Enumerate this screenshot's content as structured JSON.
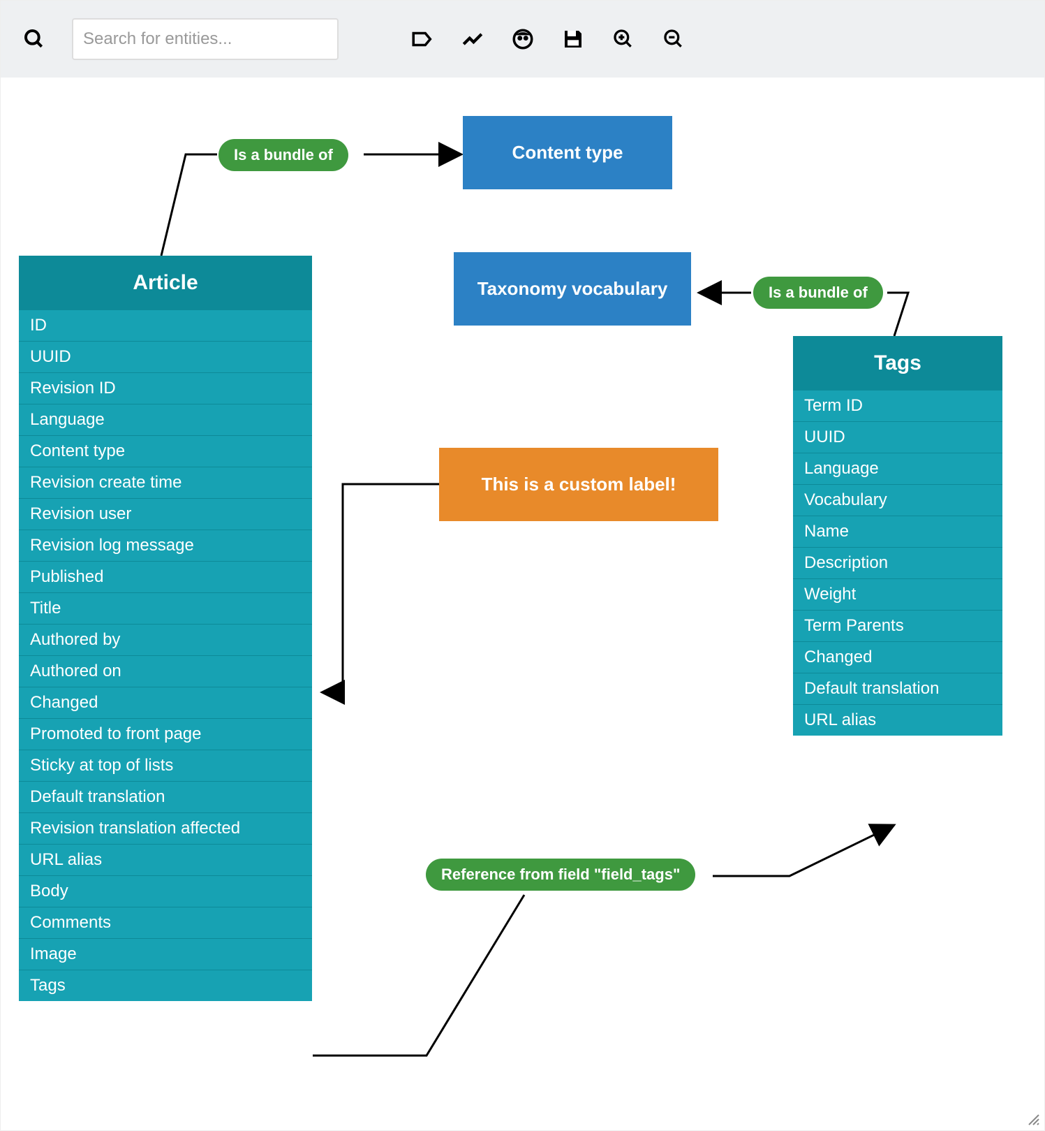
{
  "toolbar": {
    "search_placeholder": "Search for entities..."
  },
  "nodes": {
    "content_type": "Content type",
    "taxonomy_vocabulary": "Taxonomy vocabulary",
    "custom_label": "This is a custom label!"
  },
  "relations": {
    "bundle_of_1": "Is a bundle of",
    "bundle_of_2": "Is a bundle of",
    "field_tags_ref": "Reference from field \"field_tags\""
  },
  "entities": {
    "article": {
      "title": "Article",
      "fields": [
        "ID",
        "UUID",
        "Revision ID",
        "Language",
        "Content type",
        "Revision create time",
        "Revision user",
        "Revision log message",
        "Published",
        "Title",
        "Authored by",
        "Authored on",
        "Changed",
        "Promoted to front page",
        "Sticky at top of lists",
        "Default translation",
        "Revision translation affected",
        "URL alias",
        "Body",
        "Comments",
        "Image",
        "Tags"
      ]
    },
    "tags": {
      "title": "Tags",
      "fields": [
        "Term ID",
        "UUID",
        "Language",
        "Vocabulary",
        "Name",
        "Description",
        "Weight",
        "Term Parents",
        "Changed",
        "Default translation",
        "URL alias"
      ]
    }
  },
  "colors": {
    "toolbar_bg": "#eef0f2",
    "entity_header": "#0d8a98",
    "entity_body": "#17a2b3",
    "blue_box": "#2c81c5",
    "orange_box": "#e88a2a",
    "pill_green": "#3f993f"
  }
}
